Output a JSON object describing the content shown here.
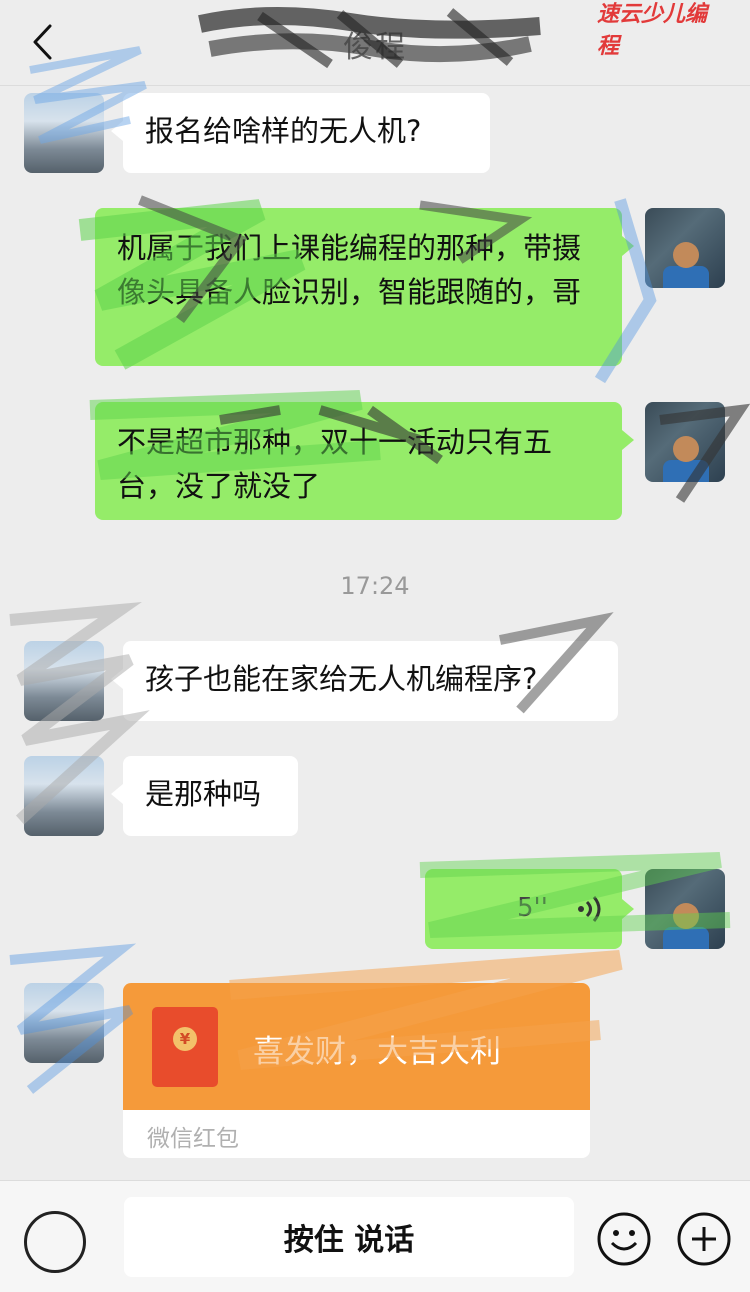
{
  "header": {
    "title": "俊程",
    "brand": "速云少儿编程"
  },
  "messages": {
    "m1": "报名给啥样的无人机?",
    "m2": "机属于我们上课能编程的那种，带摄像头具备人脸识别，智能跟随的，哥",
    "m3": "不是超市那种，双十一活动只有五台，没了就没了",
    "time": "17:24",
    "m4": "孩子也能在家给无人机编程序?",
    "m5": "是那种吗",
    "voice_duration": "5''",
    "packet_message": "喜发财，大吉大利",
    "packet_label": "微信红包"
  },
  "input": {
    "talk_label": "按住 说话"
  },
  "colors": {
    "green_bubble": "#95ec69",
    "packet_orange": "#f59a3a",
    "background": "#ededed"
  },
  "icons": {
    "back": "chevron-left-icon",
    "voice": "voice-wave-icon",
    "emoji": "smile-icon",
    "plus": "plus-circle-icon"
  }
}
